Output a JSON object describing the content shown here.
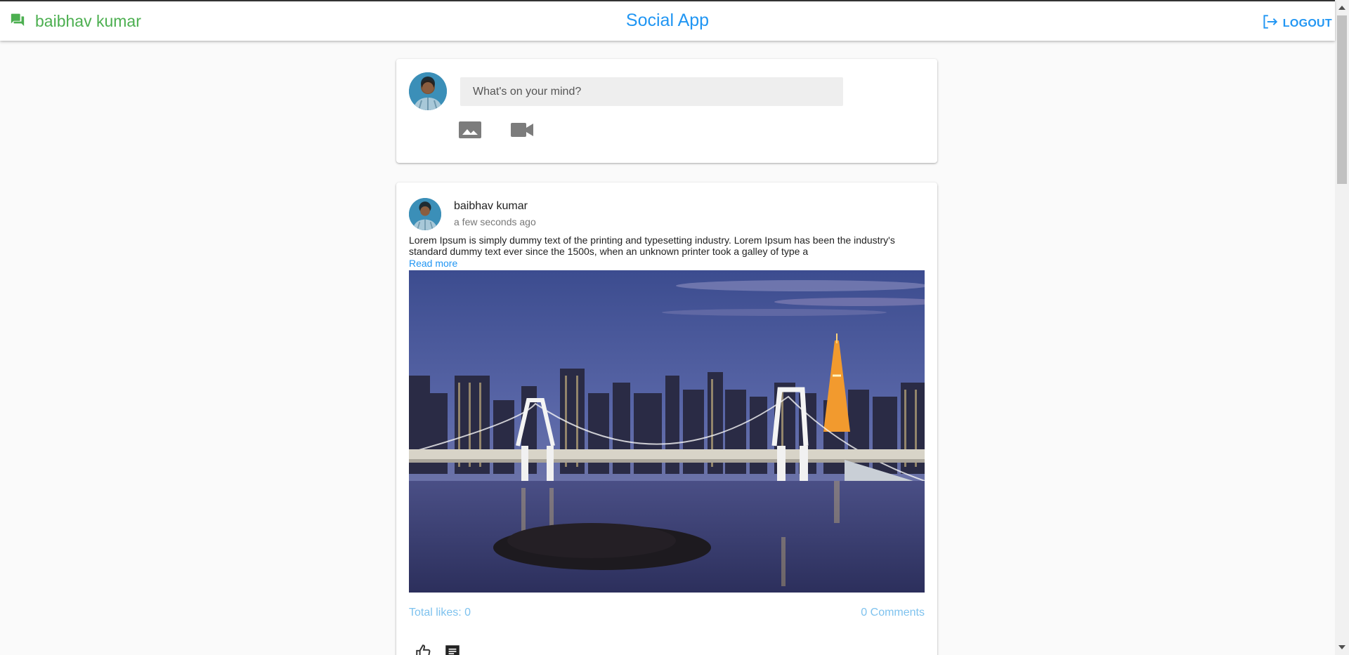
{
  "header": {
    "user_name": "baibhav kumar",
    "app_title": "Social App",
    "logout_label": "LOGOUT",
    "brand_color": "#4caf50",
    "accent_color": "#2196f3"
  },
  "composer": {
    "placeholder": "What's on your mind?",
    "icons": [
      "image-icon",
      "video-camera-icon"
    ]
  },
  "post": {
    "author": "baibhav kumar",
    "time": "a few seconds ago",
    "text": "Lorem Ipsum is simply dummy text of the printing and typesetting industry. Lorem Ipsum has been the industry's standard dummy text ever since the 1500s, when an unknown printer took a galley of type a",
    "read_more": "Read more",
    "likes_label": "Total likes: 0",
    "comments_label": "0 Comments",
    "action_icons": [
      "thumb-up-icon",
      "comment-icon"
    ]
  }
}
